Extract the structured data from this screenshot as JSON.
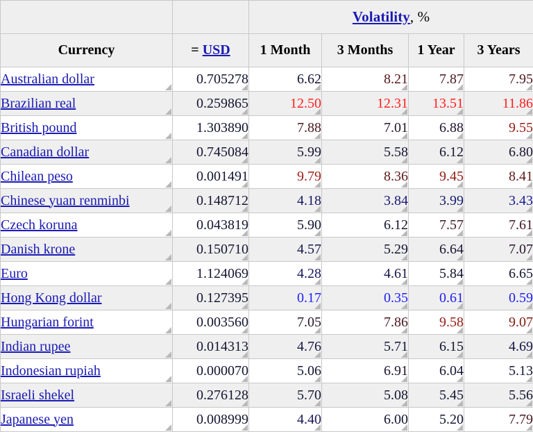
{
  "table": {
    "group_header": {
      "link_text": "Volatility",
      "suffix": ", %"
    },
    "columns": [
      {
        "key": "currency",
        "label": "Currency"
      },
      {
        "key": "usd_prefix",
        "label": "="
      },
      {
        "key": "usd_link",
        "label": "USD"
      },
      {
        "key": "m1",
        "label": "1 Month"
      },
      {
        "key": "m3",
        "label": "3 Months"
      },
      {
        "key": "y1",
        "label": "1 Year"
      },
      {
        "key": "y3",
        "label": "3 Years"
      }
    ],
    "column_headers": {
      "currency": "Currency",
      "usd_eq": "=",
      "usd": "USD",
      "m1": "1 Month",
      "m3": "3 Months",
      "y1": "1 Year",
      "y3": "3 Years"
    },
    "rows": [
      {
        "currency": "Australian dollar",
        "rate": "0.705278",
        "m1": "6.62",
        "m3": "8.21",
        "y1": "7.87",
        "y3": "7.95"
      },
      {
        "currency": "Brazilian real",
        "rate": "0.259865",
        "m1": "12.50",
        "m3": "12.31",
        "y1": "13.51",
        "y3": "11.86"
      },
      {
        "currency": "British pound",
        "rate": "1.303890",
        "m1": "7.88",
        "m3": "7.01",
        "y1": "6.88",
        "y3": "9.55"
      },
      {
        "currency": "Canadian dollar",
        "rate": "0.745084",
        "m1": "5.99",
        "m3": "5.58",
        "y1": "6.12",
        "y3": "6.80"
      },
      {
        "currency": "Chilean peso",
        "rate": "0.001491",
        "m1": "9.79",
        "m3": "8.36",
        "y1": "9.45",
        "y3": "8.41"
      },
      {
        "currency": "Chinese yuan renminbi",
        "rate": "0.148712",
        "m1": "4.18",
        "m3": "3.84",
        "y1": "3.99",
        "y3": "3.43"
      },
      {
        "currency": "Czech koruna",
        "rate": "0.043819",
        "m1": "5.90",
        "m3": "6.12",
        "y1": "7.57",
        "y3": "7.61"
      },
      {
        "currency": "Danish krone",
        "rate": "0.150710",
        "m1": "4.57",
        "m3": "5.29",
        "y1": "6.64",
        "y3": "7.07"
      },
      {
        "currency": "Euro",
        "rate": "1.124069",
        "m1": "4.28",
        "m3": "4.61",
        "y1": "5.84",
        "y3": "6.65"
      },
      {
        "currency": "Hong Kong dollar",
        "rate": "0.127395",
        "m1": "0.17",
        "m3": "0.35",
        "y1": "0.61",
        "y3": "0.59"
      },
      {
        "currency": "Hungarian forint",
        "rate": "0.003560",
        "m1": "7.05",
        "m3": "7.86",
        "y1": "9.58",
        "y3": "9.07"
      },
      {
        "currency": "Indian rupee",
        "rate": "0.014313",
        "m1": "4.76",
        "m3": "5.71",
        "y1": "6.15",
        "y3": "4.69"
      },
      {
        "currency": "Indonesian rupiah",
        "rate": "0.000070",
        "m1": "5.06",
        "m3": "6.91",
        "y1": "6.04",
        "y3": "5.13"
      },
      {
        "currency": "Israeli shekel",
        "rate": "0.276128",
        "m1": "5.70",
        "m3": "5.08",
        "y1": "5.45",
        "y3": "5.56"
      },
      {
        "currency": "Japanese yen",
        "rate": "0.008999",
        "m1": "4.40",
        "m3": "6.00",
        "y1": "5.20",
        "y3": "7.79"
      }
    ],
    "colors": {
      "link": "#1a1ab4",
      "low": "#2222ff",
      "mid": "#141432",
      "high": "#7a1a10",
      "very_high": "#ff2020",
      "header_bg": "#efefef",
      "row_alt_bg": "#efefef",
      "border": "#c8c8c8"
    },
    "color_scale": {
      "low_value": 0.17,
      "mid_value": 6.2,
      "high_value": 13.51,
      "description": "blue = low volatility, navy = mid, dark red = high, bright red = highest"
    }
  }
}
